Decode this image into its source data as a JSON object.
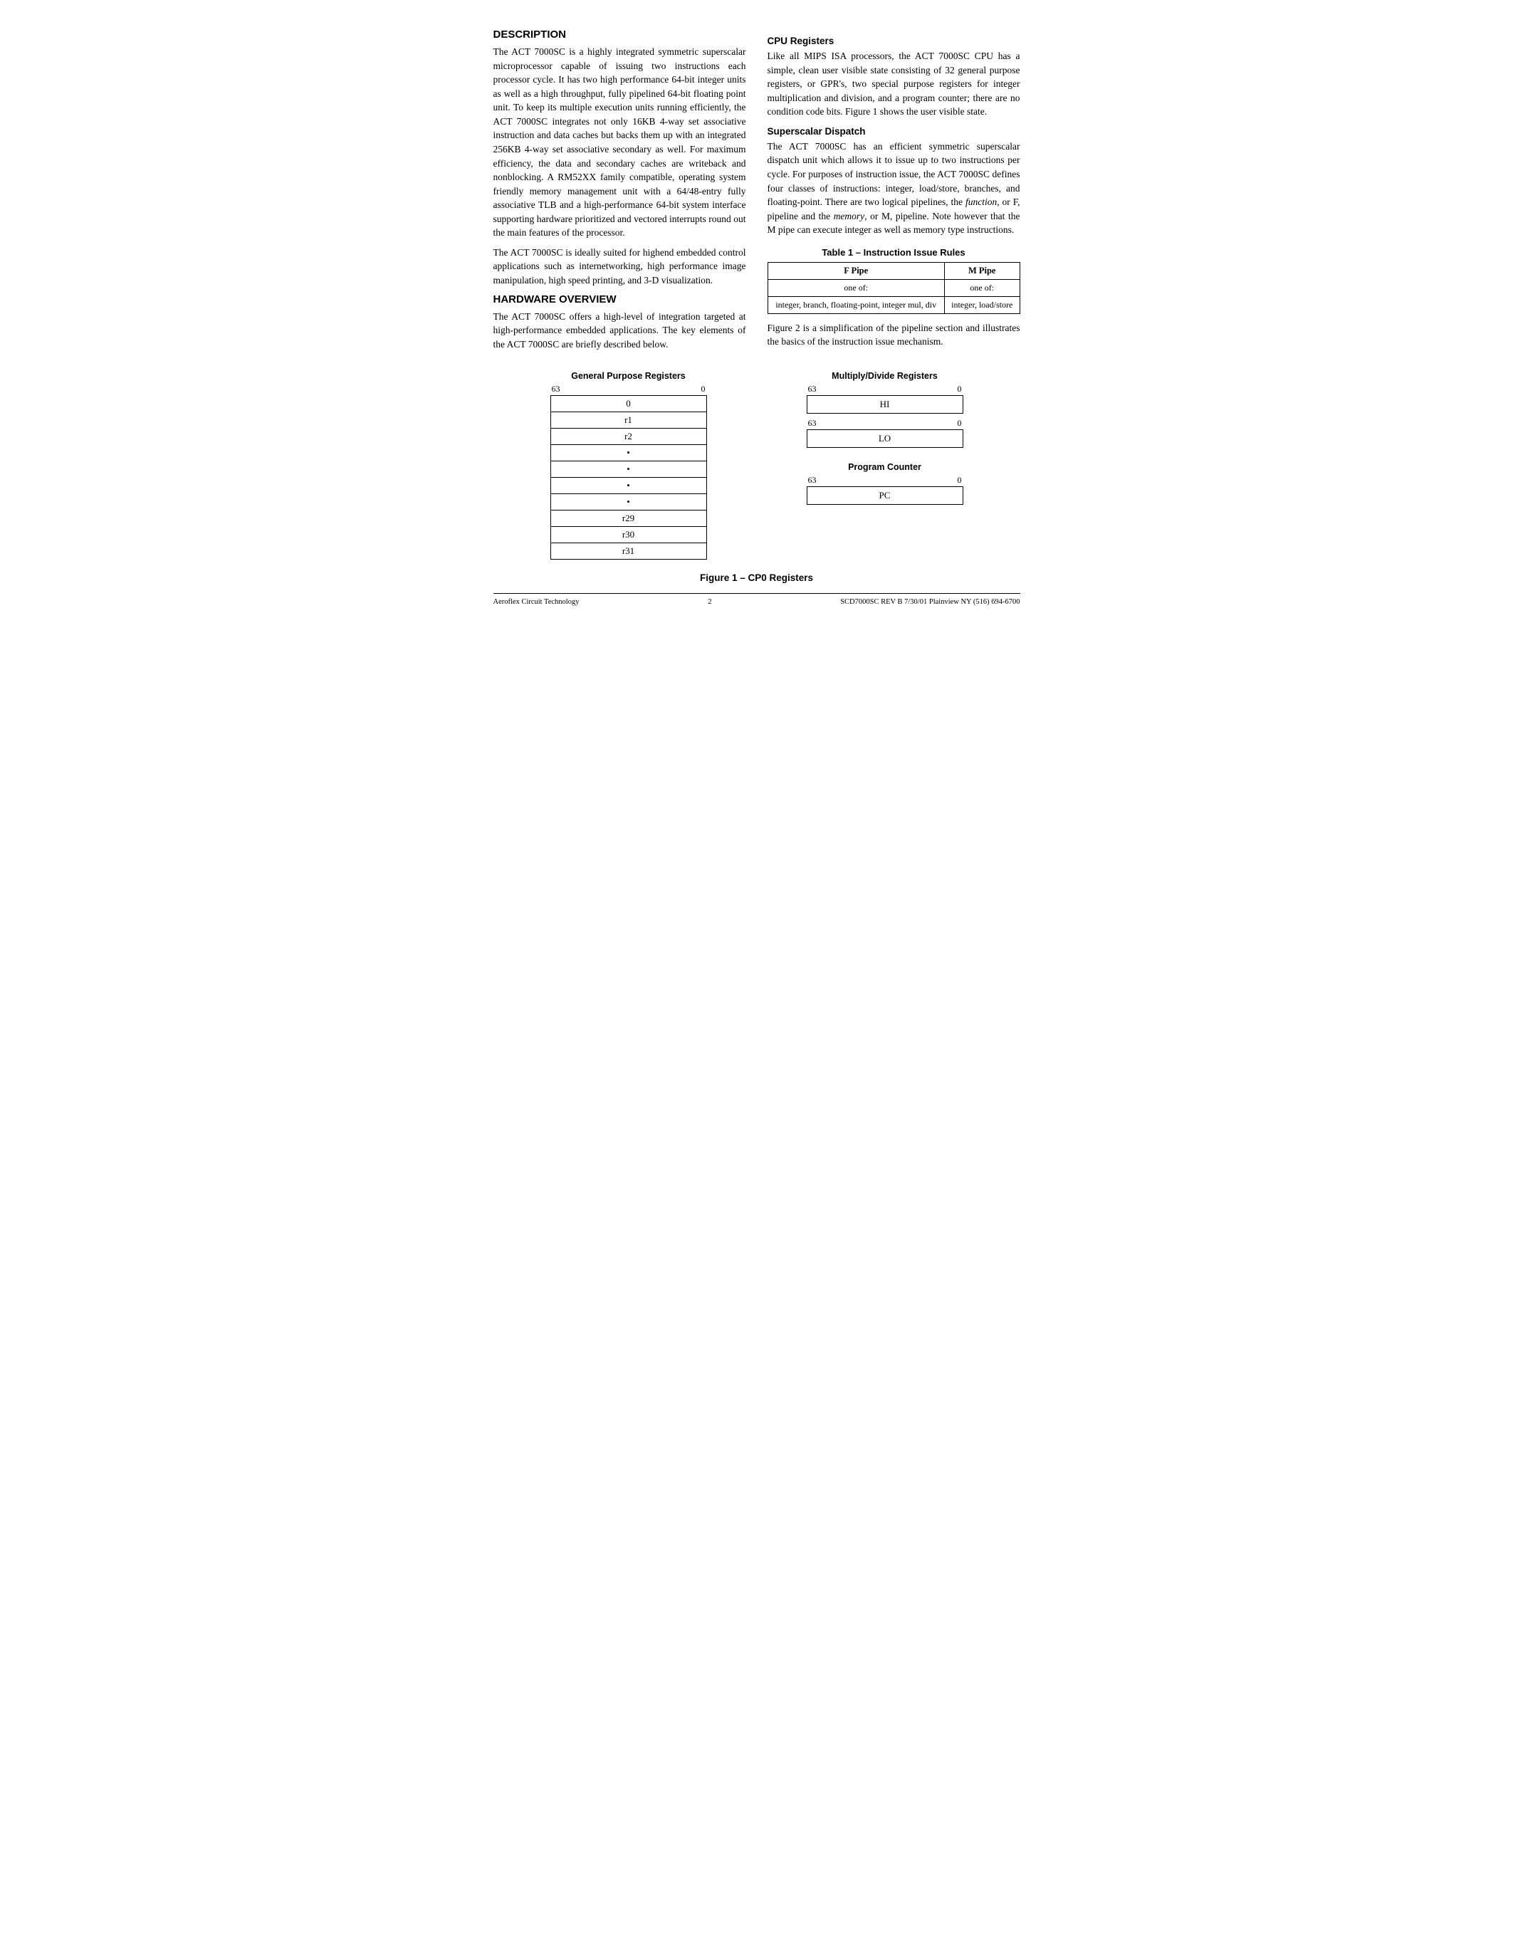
{
  "description": {
    "title": "DESCRIPTION",
    "para1": "The ACT 7000SC is a highly integrated symmetric superscalar microprocessor capable of issuing two instructions each processor cycle. It has two high performance 64-bit integer units as well as a high throughput, fully pipelined 64-bit floating point unit. To keep its multiple execution units running efficiently, the ACT 7000SC integrates not only 16KB 4-way set associative instruction and data caches but backs them up with an integrated 256KB 4-way set associative secondary as well. For maximum efficiency, the data and secondary caches are writeback and nonblocking. A RM52XX family compatible, operating system friendly memory management unit with a 64/48-entry fully associative TLB and a high-performance 64-bit system interface supporting hardware prioritized and vectored interrupts round out the main features of the processor.",
    "para2": "The ACT 7000SC is ideally suited for highend embedded control applications such as internetworking, high performance image manipulation, high speed printing, and 3-D visualization."
  },
  "hardware_overview": {
    "title": "HARDWARE OVERVIEW",
    "para1": "The ACT 7000SC offers a high-level of integration targeted at high-performance embedded applications. The key elements of the ACT 7000SC are briefly described below."
  },
  "cpu_registers": {
    "title": "CPU Registers",
    "para1": "Like all MIPS ISA processors, the ACT 7000SC CPU has a simple, clean user visible state consisting of 32 general purpose registers, or GPR's, two special purpose registers for integer multiplication and division, and a program counter; there are no condition code bits. Figure 1 shows the user visible state."
  },
  "superscalar_dispatch": {
    "title": "Superscalar Dispatch",
    "para1_part1": "The ACT 7000SC has an efficient symmetric superscalar dispatch unit which allows it to issue up to two instructions per cycle. For purposes of instruction issue, the ACT 7000SC defines four classes of instructions: integer, load/store, branches, and floating-point. There are two logical pipelines, the ",
    "function_italic": "function",
    "para1_part2": ", or F, pipeline and the ",
    "memory_italic": "memory",
    "para1_part3": ", or M, pipeline. Note however that the M pipe can execute integer as well as memory type instructions."
  },
  "table": {
    "title": "Table 1 – Instruction Issue Rules",
    "col1_header": "F Pipe",
    "col2_header": "M Pipe",
    "row1_col1": "one of:",
    "row1_col2": "one of:",
    "row2_col1": "integer, branch, floating-point, integer mul, div",
    "row2_col2": "integer, load/store"
  },
  "figure_note": "Figure 2 is a simplification of the pipeline section and illustrates the basics of the instruction issue mechanism.",
  "diagrams": {
    "gpr": {
      "title": "General Purpose Registers",
      "range_left": "63",
      "range_right": "0",
      "registers": [
        "0",
        "r1",
        "r2",
        "•",
        "•",
        "•",
        "•",
        "r29",
        "r30",
        "r31"
      ]
    },
    "multiply_divide": {
      "title": "Multiply/Divide Registers",
      "hi_range_left": "63",
      "hi_range_right": "0",
      "hi_label": "HI",
      "lo_range_left": "63",
      "lo_range_right": "0",
      "lo_label": "LO"
    },
    "program_counter": {
      "title": "Program Counter",
      "range_left": "63",
      "range_right": "0",
      "label": "PC"
    }
  },
  "figure_caption": "Figure 1 – CP0 Registers",
  "footer": {
    "left": "Aeroflex Circuit Technology",
    "center": "2",
    "right": "SCD7000SC REV B  7/30/01 Plainview NY (516) 694-6700"
  }
}
